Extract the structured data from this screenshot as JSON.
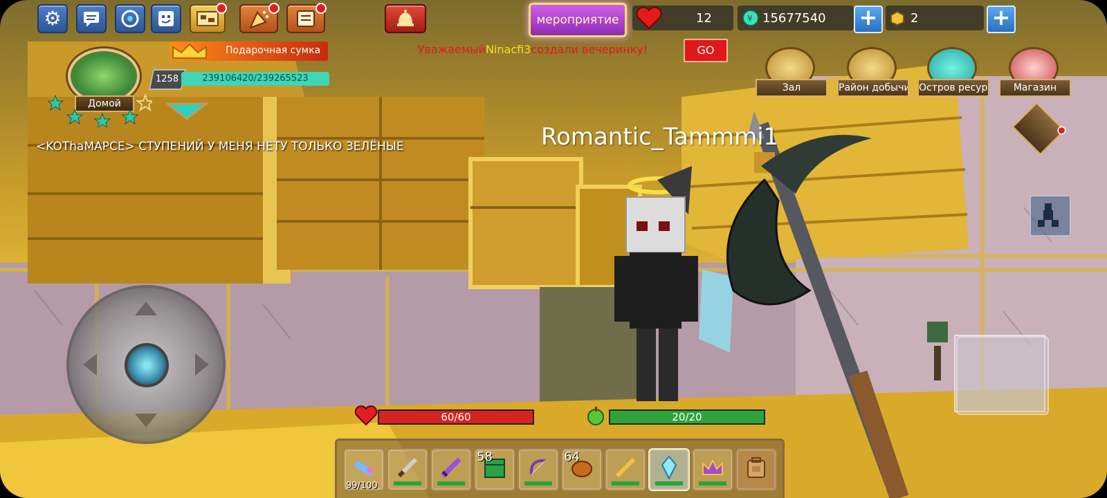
{
  "top_bar": {
    "event_button_label": "мероприятие",
    "health_count": "12",
    "coins": "15677540",
    "cubes": "2"
  },
  "gift_bag": {
    "label": "Подарочная сумка"
  },
  "announcement": {
    "prefix": "Уважаемый",
    "name": "Ninacfi3",
    "suffix": "создали вечеринку!",
    "go_label": "GO"
  },
  "player": {
    "level": "1258",
    "exp": "239106420/239265523",
    "home_label": "Домой"
  },
  "chat": {
    "message": "<KOThaMAPCE> СТУПЕНИЙ У МЕНЯ НЕТУ ТОЛЬКО ЗЕЛЁНЫЕ"
  },
  "places": [
    {
      "label": "Зал"
    },
    {
      "label": "Район добычи"
    },
    {
      "label": "Остров ресурсов"
    },
    {
      "label": "Магазин"
    }
  ],
  "nametag": "Romantic_Tammmi1",
  "vitals": {
    "hp": "60/60",
    "hunger": "20/20",
    "hp_fraction": 1.0,
    "hunger_fraction": 1.0
  },
  "hotbar": {
    "slots": [
      {
        "name": "blaster",
        "count": "",
        "sub": "99/100"
      },
      {
        "name": "knife",
        "count": "",
        "sub": ""
      },
      {
        "name": "purple-sword",
        "count": "",
        "sub": ""
      },
      {
        "name": "green-block",
        "count": "58",
        "sub": ""
      },
      {
        "name": "bow",
        "count": "",
        "sub": ""
      },
      {
        "name": "bread",
        "count": "64",
        "sub": ""
      },
      {
        "name": "golden-sword",
        "count": "",
        "sub": ""
      },
      {
        "name": "crystal",
        "count": "",
        "sub": "",
        "selected": true
      },
      {
        "name": "crown",
        "count": "",
        "sub": ""
      },
      {
        "name": "backpack",
        "count": "",
        "sub": ""
      }
    ]
  },
  "colors": {
    "accent_blue": "#2b5596",
    "hp_red": "#e02020",
    "hunger_green": "#2aa33a",
    "announce_red": "#e21b1b",
    "announce_name": "#f6e21a",
    "exp_teal": "#3ed6b4"
  }
}
